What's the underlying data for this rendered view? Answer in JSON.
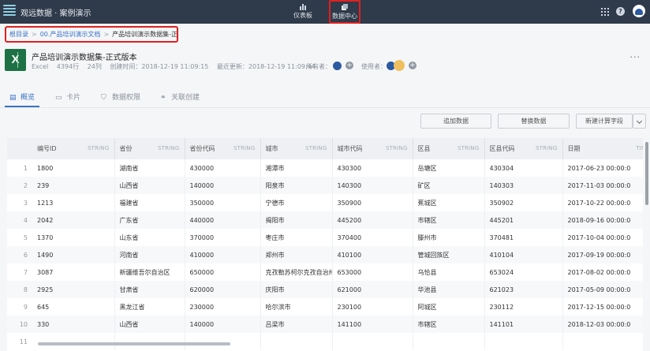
{
  "app": {
    "title": "观远数据 · 案例演示",
    "nav": [
      {
        "label": "仪表板",
        "icon": "bar-chart-icon"
      },
      {
        "label": "数据中心",
        "icon": "data-center-icon"
      }
    ]
  },
  "breadcrumb": {
    "root": "根目录",
    "folder": "00.产品培训演示文档",
    "current": "产品培训演示数据集-正式…",
    "separator": ">"
  },
  "dataset": {
    "name": "产品培训演示数据集-正式版本",
    "type": "Excel",
    "rows": "4394行",
    "cols": "24列",
    "created": "创建时间：2018-12-19 11:09:15",
    "updated": "最近更新：2018-12-19 11:09:44",
    "owner_label": "所有者：",
    "user_label": "使用者：",
    "more": "···"
  },
  "tabs": [
    {
      "label": "概览",
      "icon": "overview-icon"
    },
    {
      "label": "卡片",
      "icon": "card-icon"
    },
    {
      "label": "数据权限",
      "icon": "shield-icon"
    },
    {
      "label": "关联创建",
      "icon": "link-icon"
    }
  ],
  "toolbar": {
    "add_label": "追加数据",
    "replace_label": "替换数据",
    "newfield_label": "新建计算字段"
  },
  "table": {
    "columns": [
      {
        "name": "编号ID",
        "type": "STRING"
      },
      {
        "name": "省份",
        "type": "STRING"
      },
      {
        "name": "省份代码",
        "type": "STRING"
      },
      {
        "name": "城市",
        "type": "STRING"
      },
      {
        "name": "城市代码",
        "type": "STRING"
      },
      {
        "name": "区县",
        "type": "STRING"
      },
      {
        "name": "区县代码",
        "type": "STRING"
      },
      {
        "name": "日期",
        "type": "TIMEST"
      }
    ],
    "rows": [
      [
        "1",
        "1800",
        "湖南省",
        "430000",
        "湘潭市",
        "430300",
        "岳塘区",
        "430304",
        "2017-06-23 00:00:0"
      ],
      [
        "2",
        "239",
        "山西省",
        "140000",
        "阳泉市",
        "140300",
        "矿区",
        "140303",
        "2017-11-03 00:00:0"
      ],
      [
        "3",
        "1213",
        "福建省",
        "350000",
        "宁德市",
        "350900",
        "蕉城区",
        "350902",
        "2017-10-22 00:00:0"
      ],
      [
        "4",
        "2042",
        "广东省",
        "440000",
        "揭阳市",
        "445200",
        "市辖区",
        "445201",
        "2018-09-16 00:00:0"
      ],
      [
        "5",
        "1370",
        "山东省",
        "370000",
        "枣庄市",
        "370400",
        "滕州市",
        "370481",
        "2017-10-04 00:00:0"
      ],
      [
        "6",
        "1490",
        "河南省",
        "410000",
        "郑州市",
        "410100",
        "管城回族区",
        "410104",
        "2017-09-19 00:00:0"
      ],
      [
        "7",
        "3087",
        "新疆维吾尔自治区",
        "650000",
        "克孜勒苏柯尔克孜自治州",
        "653000",
        "乌恰县",
        "653024",
        "2017-08-02 00:00:0"
      ],
      [
        "8",
        "2925",
        "甘肃省",
        "620000",
        "庆阳市",
        "621000",
        "华池县",
        "621023",
        "2017-05-09 00:00:0"
      ],
      [
        "9",
        "645",
        "黑龙江省",
        "230000",
        "哈尔滨市",
        "230100",
        "阿城区",
        "230112",
        "2017-12-15 00:00:0"
      ],
      [
        "10",
        "330",
        "山西省",
        "140000",
        "吕梁市",
        "141100",
        "市辖区",
        "141101",
        "2018-12-03 00:00:0"
      ],
      [
        "11",
        "",
        "",
        "",
        "",
        "",
        "",
        "",
        ""
      ]
    ]
  }
}
